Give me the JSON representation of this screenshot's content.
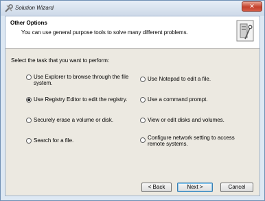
{
  "window": {
    "title": "Solution Wizard",
    "close_glyph": "✕"
  },
  "header": {
    "title": "Other Options",
    "subtitle": "You can use general purpose tools to solve many different problems."
  },
  "section": {
    "prompt": "Select the task that you want to perform:"
  },
  "options": [
    {
      "label_line1": "Use Explorer to browse through the file",
      "label_line2": "system.",
      "checked": false
    },
    {
      "label_line1": "Use Notepad to edit a file.",
      "label_line2": "",
      "checked": false
    },
    {
      "label_line1": "Use Registry Editor to edit the registry.",
      "label_line2": "",
      "checked": true
    },
    {
      "label_line1": "Use a command prompt.",
      "label_line2": "",
      "checked": false
    },
    {
      "label_line1": "Securely erase a volume or disk.",
      "label_line2": "",
      "checked": false
    },
    {
      "label_line1": "View or edit disks and volumes.",
      "label_line2": "",
      "checked": false
    },
    {
      "label_line1": "Search for a file.",
      "label_line2": "",
      "checked": false
    },
    {
      "label_line1": "Configure network setting to access",
      "label_line2": "remote systems.",
      "checked": false
    }
  ],
  "buttons": {
    "back": "< Back",
    "next": "Next >",
    "cancel": "Cancel"
  },
  "icons": {
    "title_icon": "wizard-tools-icon",
    "header_icon": "computer-tower-tools-icon"
  }
}
